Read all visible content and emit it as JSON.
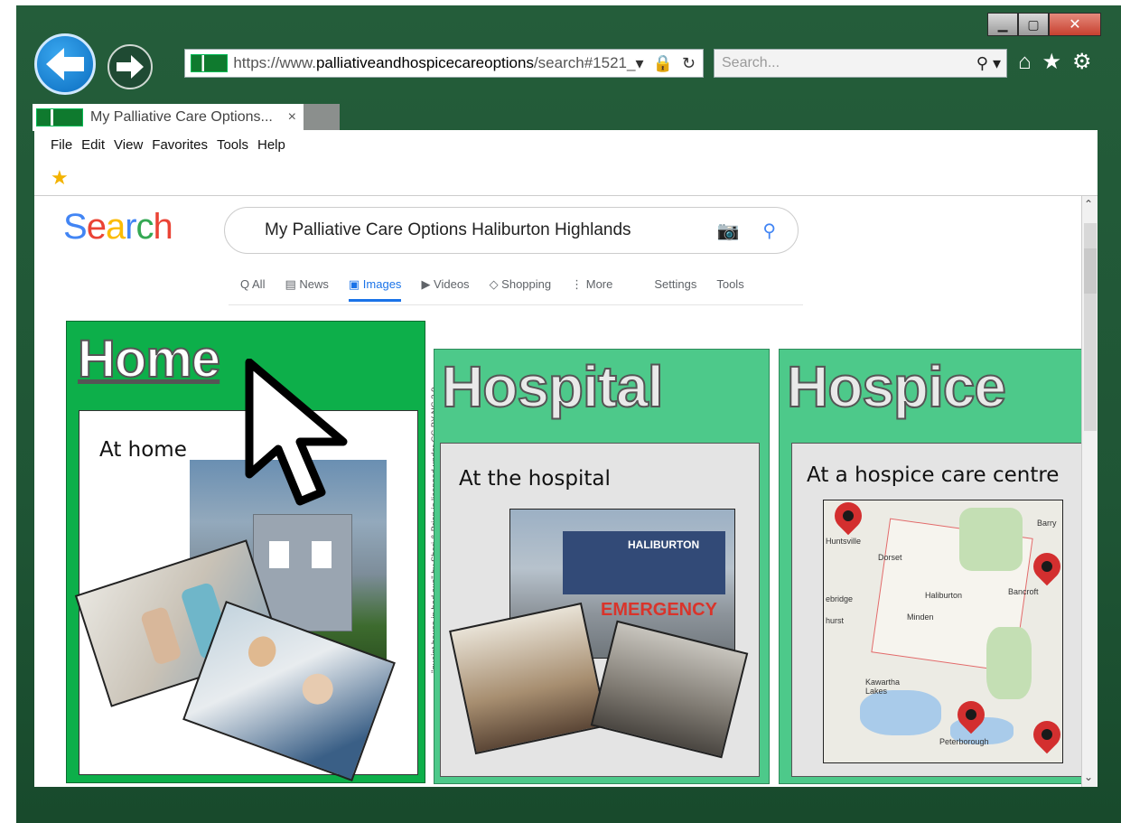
{
  "browser": {
    "url_prefix": "https://www.",
    "url_domain": "palliativeandhospicecareoptions",
    "url_suffix": "/search#1521_",
    "search_placeholder": "Search...",
    "tab_title": "My Palliative Care Options...",
    "tab_close": "×",
    "menu": [
      "File",
      "Edit",
      "View",
      "Favorites",
      "Tools",
      "Help"
    ]
  },
  "google": {
    "logo": "Search",
    "query": "My Palliative Care Options Haliburton Highlands",
    "tabs": [
      "Q All",
      "News",
      "Images",
      "Videos",
      "Shopping",
      "⋮ More",
      "Settings",
      "Tools"
    ],
    "selected_tab": "Images"
  },
  "panels": {
    "home": {
      "title": "Home",
      "caption": "At home",
      "credit": "\"quaint house in bad axe\" by Sheri & Brian is licensed under CC BY-NC 2.0."
    },
    "hospital": {
      "title": "Hospital",
      "caption": "At the hospital",
      "sign": "HALIBURTON",
      "emergency": "EMERGENCY"
    },
    "hospice": {
      "title": "Hospice",
      "caption": "At a hospice care centre",
      "map_labels": [
        "Huntsville",
        "Dorset",
        "Haliburton",
        "Minden",
        "Bancroft",
        "Kawartha Lakes",
        "Peterborough",
        "Barry",
        "hurst",
        "ebridge"
      ]
    }
  },
  "colors": {
    "home_bg": "#0daf4a",
    "panel_bg": "#4dc98a",
    "frame": "#245d3a",
    "accent": "#1a73e8"
  }
}
